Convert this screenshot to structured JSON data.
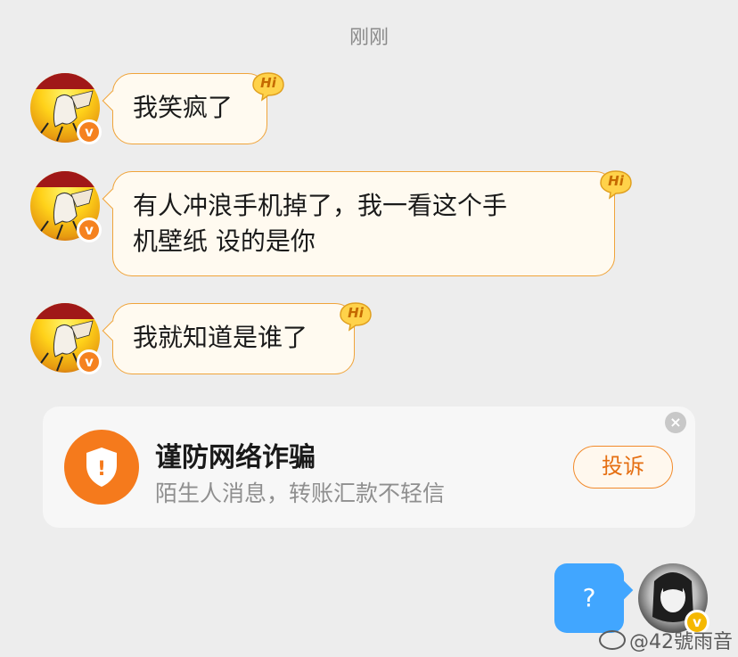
{
  "timestamp": "刚刚",
  "messages": [
    {
      "sender": "other",
      "text": "我笑疯了",
      "sticker": "Hi"
    },
    {
      "sender": "other",
      "text_line1": "有人冲浪手机掉了，我一看这个手",
      "text_line2": "机壁纸 设的是你",
      "sticker": "Hi"
    },
    {
      "sender": "other",
      "text": "我就知道是谁了",
      "sticker": "Hi"
    }
  ],
  "fraud_warning": {
    "title": "谨防网络诈骗",
    "subtitle": "陌生人消息，转账汇款不轻信",
    "report_label": "投诉",
    "close_glyph": "×",
    "shield_glyph": "!"
  },
  "my_message": {
    "text": "?"
  },
  "verified_badge": "v",
  "watermark": "@42號雨音",
  "colors": {
    "accent_orange": "#f57a1c",
    "bubble_border": "#f0a43a",
    "my_bubble": "#41a6ff",
    "background": "#ededed"
  }
}
